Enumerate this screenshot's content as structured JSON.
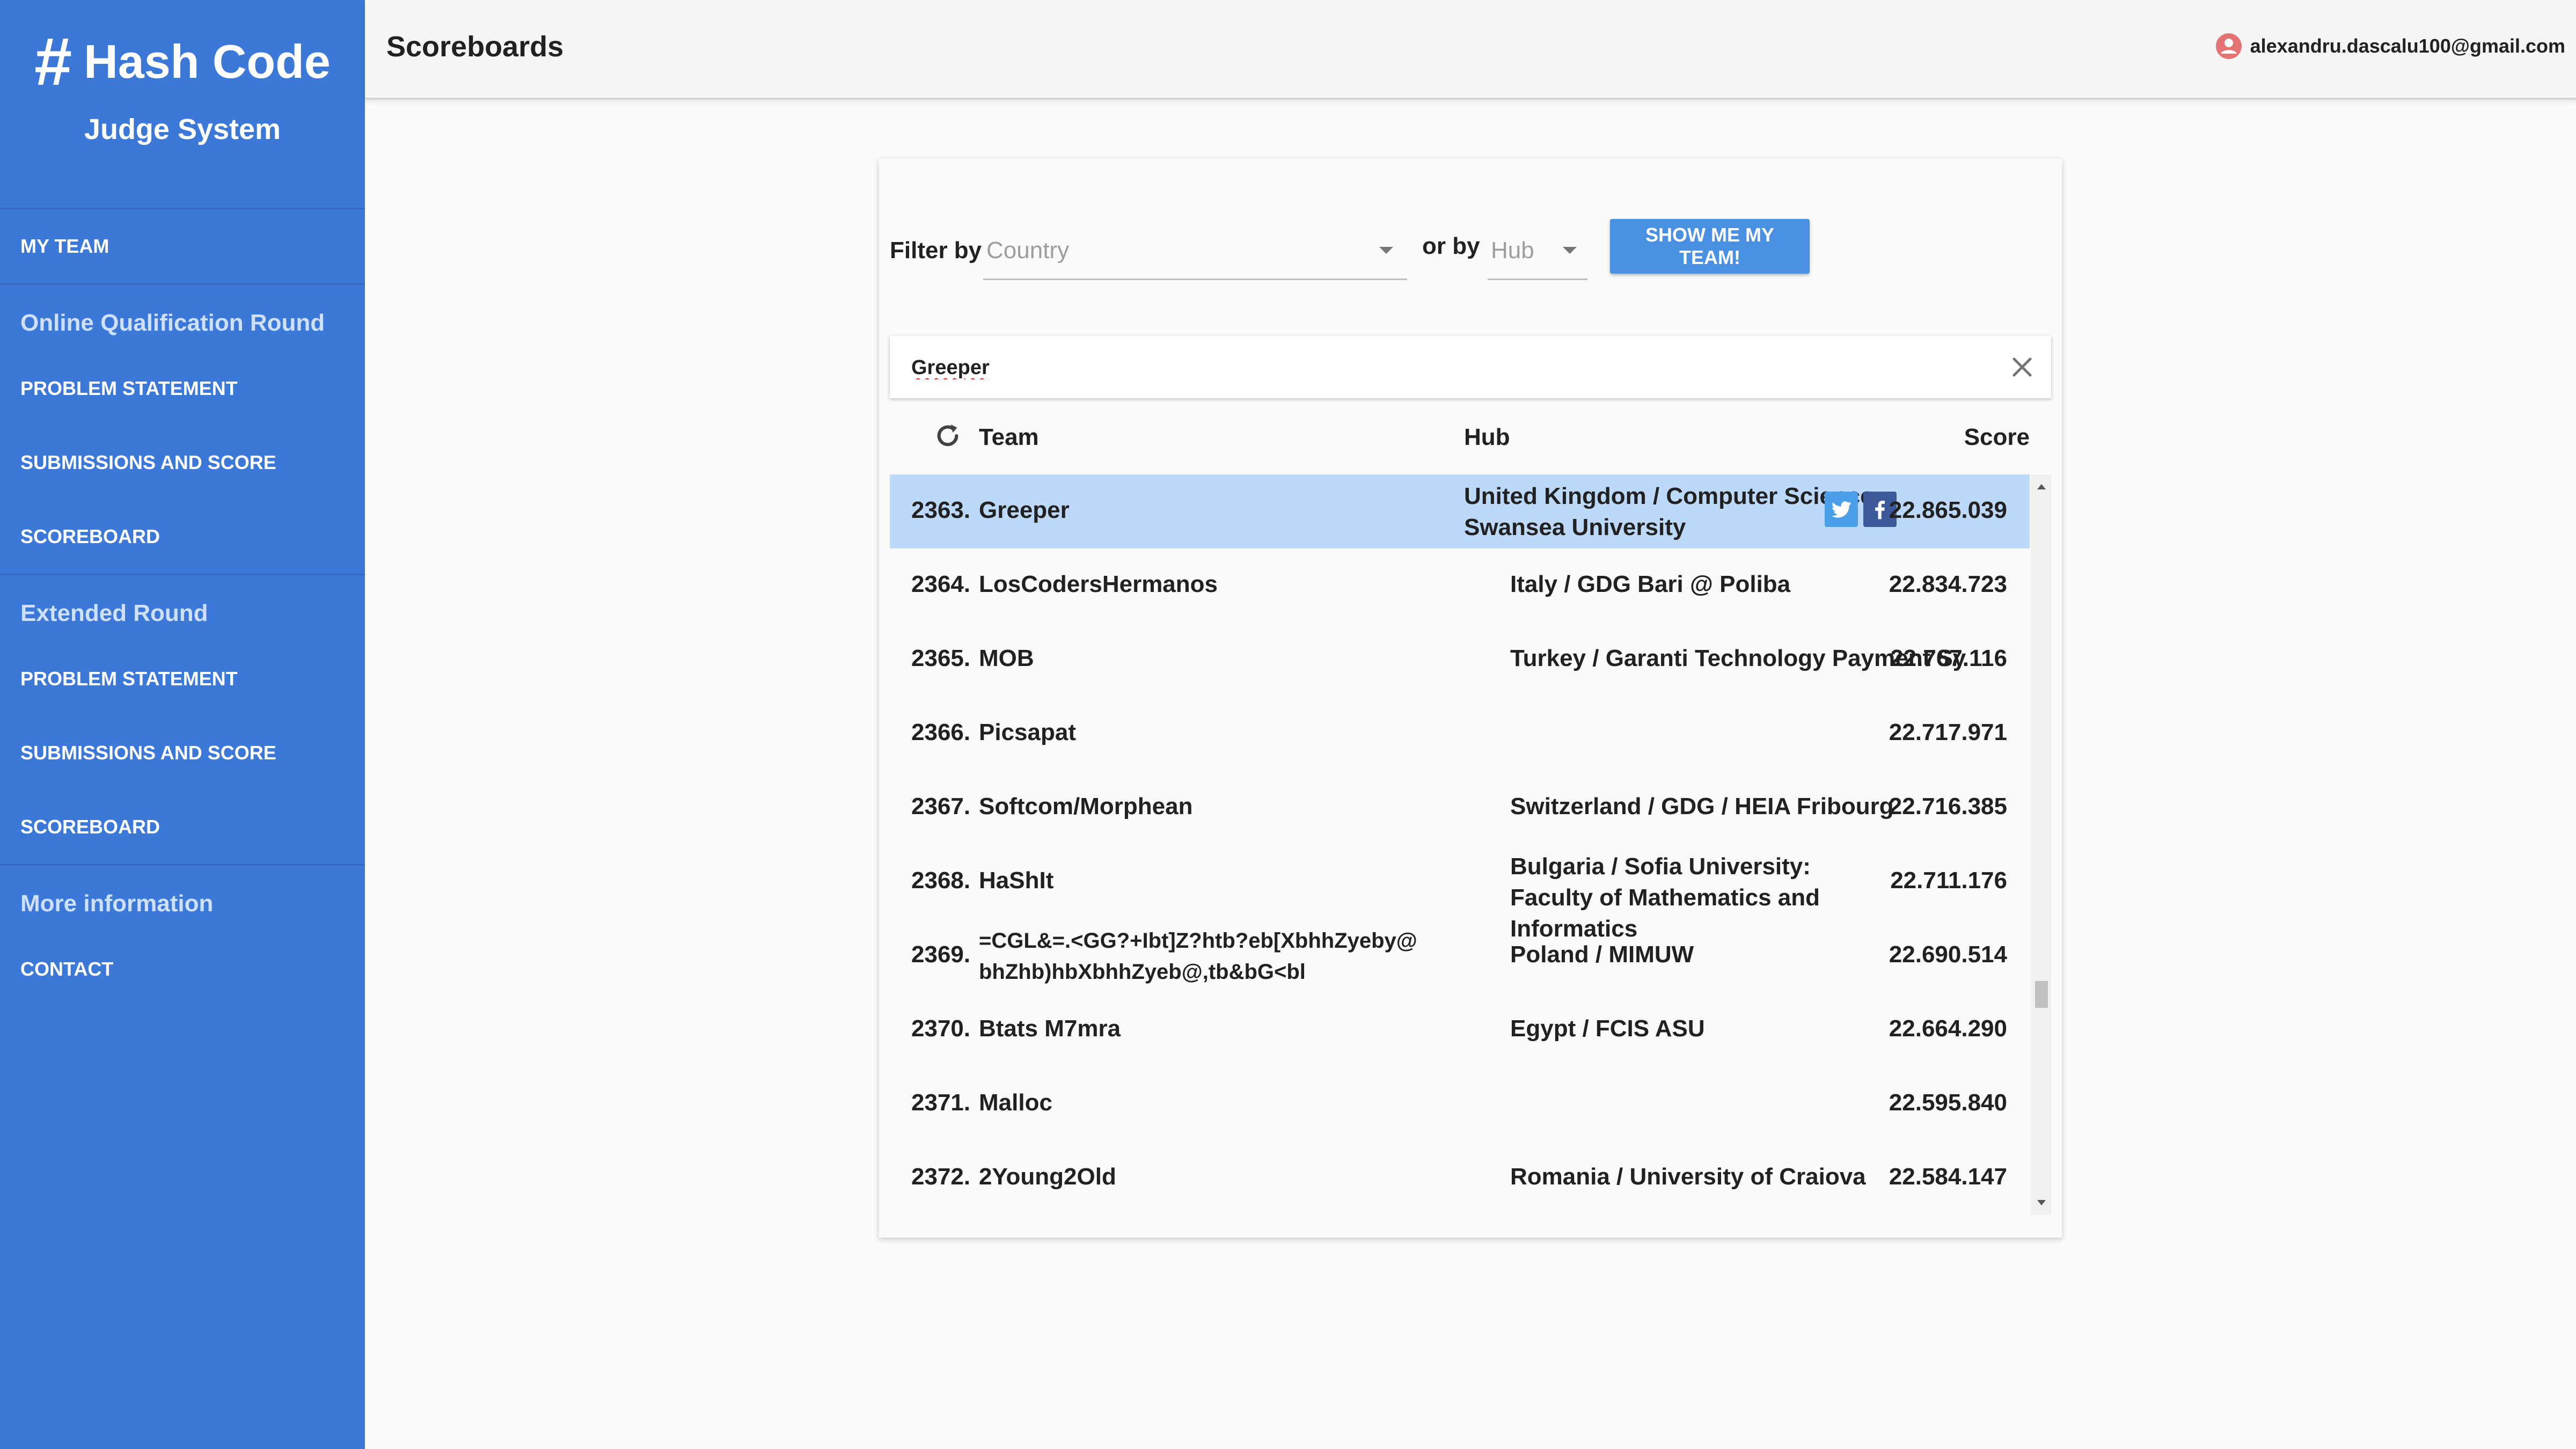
{
  "sidebar": {
    "brand_hash": "#",
    "brand_name": "Hash Code",
    "brand_sub": "Judge System",
    "my_team": "MY TEAM",
    "online_section": "Online Qualification Round",
    "online_items": [
      "PROBLEM STATEMENT",
      "SUBMISSIONS AND SCORE",
      "SCOREBOARD"
    ],
    "extended_section": "Extended Round",
    "extended_items": [
      "PROBLEM STATEMENT",
      "SUBMISSIONS AND SCORE",
      "SCOREBOARD"
    ],
    "more_section": "More information",
    "contact": "CONTACT"
  },
  "header": {
    "title": "Scoreboards",
    "user_email": "alexandru.dascalu100@gmail.com"
  },
  "filters": {
    "filter_by_label": "Filter by",
    "country_value": "Country",
    "or_by_label": "or by",
    "hub_value": "Hub",
    "show_team_label": "SHOW ME MY TEAM!"
  },
  "search": {
    "value": "Greeper"
  },
  "table": {
    "columns": {
      "team": "Team",
      "hub": "Hub",
      "score": "Score"
    },
    "rows": [
      {
        "rank": "2363.",
        "team": "Greeper",
        "hub": "United Kingdom / Computer Science Swansea University",
        "score": "22.865.039",
        "selected": true
      },
      {
        "rank": "2364.",
        "team": "LosCodersHermanos",
        "hub": "Italy / GDG Bari @ Poliba",
        "score": "22.834.723"
      },
      {
        "rank": "2365.",
        "team": "MOB",
        "hub": "Turkey / Garanti Technology Payment Systems",
        "score": "22.767.116"
      },
      {
        "rank": "2366.",
        "team": "Picsapat",
        "hub": "",
        "score": "22.717.971"
      },
      {
        "rank": "2367.",
        "team": "Softcom/Morphean",
        "hub": "Switzerland / GDG / HEIA Fribourg",
        "score": "22.716.385"
      },
      {
        "rank": "2368.",
        "team": "HaShIt",
        "hub": "Bulgaria / Sofia University: Faculty of Mathematics and Informatics",
        "score": "22.711.176"
      },
      {
        "rank": "2369.",
        "team": "=CGL&=.<GG?+Ibt]Z?htb?eb[XbhhZyeby@bhZhb)hbXbhhZyeb@,tb&bG<bl",
        "hub": "Poland / MIMUW",
        "score": "22.690.514"
      },
      {
        "rank": "2370.",
        "team": "Btats M7mra",
        "hub": "Egypt / FCIS ASU",
        "score": "22.664.290"
      },
      {
        "rank": "2371.",
        "team": "Malloc",
        "hub": "",
        "score": "22.595.840"
      },
      {
        "rank": "2372.",
        "team": "2Young2Old",
        "hub": "Romania / University of Craiova",
        "score": "22.584.147"
      }
    ]
  },
  "icons": {
    "user": "user-icon",
    "clear": "close-icon",
    "refresh": "refresh-icon",
    "twitter": "twitter-icon",
    "facebook": "facebook-icon"
  },
  "colors": {
    "sidebar": "#3c78d8",
    "accent_button": "#4a90e2",
    "selected_row": "#bcd9f9"
  }
}
